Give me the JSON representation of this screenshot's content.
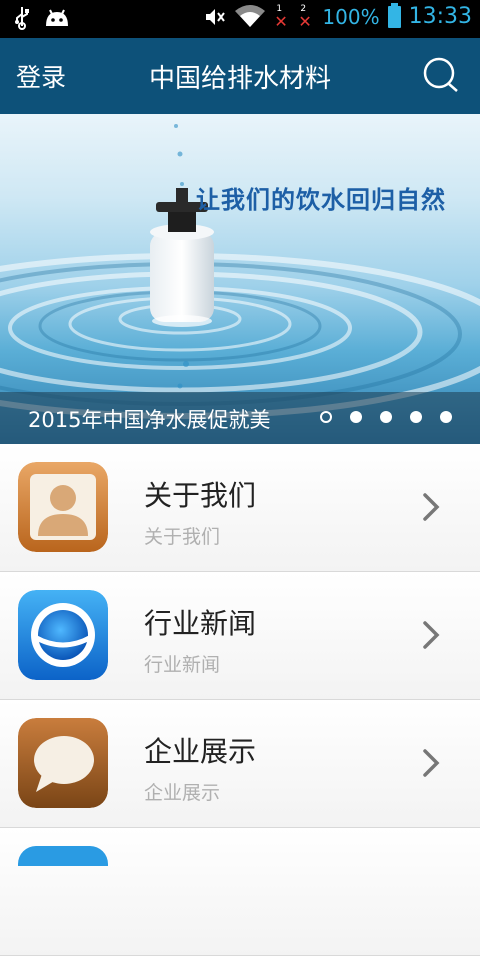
{
  "status_bar": {
    "battery_text": "100%",
    "time": "13:33",
    "sim1_label": "1",
    "sim2_label": "2",
    "icons": [
      "usb-icon",
      "android-debug-icon",
      "mute-icon",
      "wifi-icon",
      "sim1-no-signal-icon",
      "sim2-no-signal-icon",
      "battery-icon"
    ]
  },
  "header": {
    "login_label": "登录",
    "title": "中国给排水材料",
    "search_icon": "search-icon",
    "color": "#0d5179"
  },
  "banner": {
    "slogan": "让我们的饮水回归自然",
    "caption": "2015年中国净水展促就美",
    "slides_total": 5,
    "active_slide": 1
  },
  "menu": {
    "items": [
      {
        "title": "关于我们",
        "subtitle": "关于我们",
        "icon": "user-profile-icon"
      },
      {
        "title": "行业新闻",
        "subtitle": "行业新闻",
        "icon": "news-globe-icon"
      },
      {
        "title": "企业展示",
        "subtitle": "企业展示",
        "icon": "speech-bubble-icon"
      }
    ]
  }
}
